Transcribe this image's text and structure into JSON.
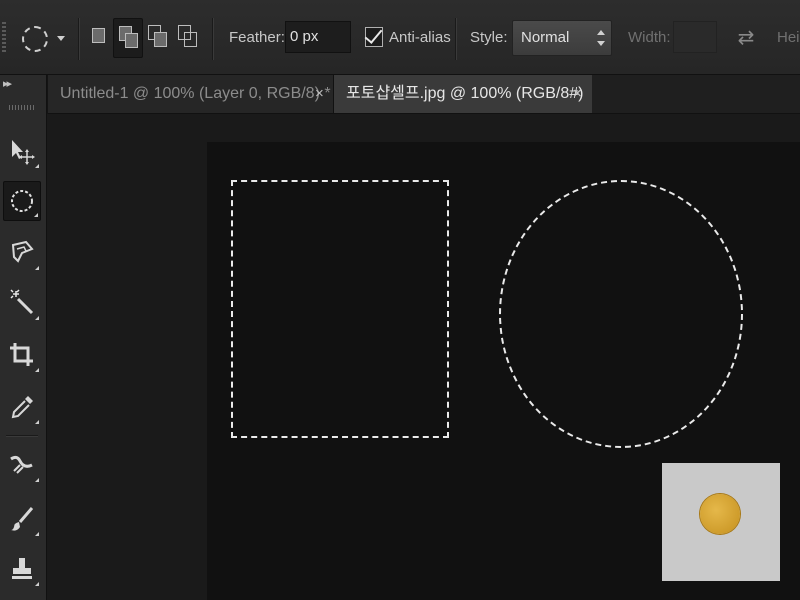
{
  "options_bar": {
    "feather_label": "Feather:",
    "feather_value": "0 px",
    "antialias_label": "Anti-alias",
    "antialias_checked": true,
    "style_label": "Style:",
    "style_value": "Normal",
    "width_label": "Width:",
    "height_label": "Heig",
    "tool_icon": "elliptical-marquee-icon",
    "selection_modes": [
      "new-selection",
      "add-to-selection",
      "subtract-from-selection",
      "intersect-with-selection"
    ],
    "active_selection_mode": "add-to-selection"
  },
  "tabs": [
    {
      "label": "Untitled-1 @ 100% (Layer 0, RGB/8) *",
      "close": "×",
      "active": false
    },
    {
      "label": "포토샵셀프.jpg @ 100% (RGB/8#)",
      "close": "×",
      "active": true
    }
  ],
  "tools_panel": {
    "collapse_glyph": "▸▸",
    "tools": [
      "move-tool-icon",
      "elliptical-marquee-tool-icon",
      "lasso-tool-icon",
      "magic-wand-tool-icon",
      "crop-tool-icon",
      "eyedropper-tool-icon",
      "healing-brush-tool-icon",
      "brush-tool-icon",
      "clone-stamp-tool-icon"
    ],
    "active_tool": "elliptical-marquee-tool-icon"
  },
  "canvas": {
    "background": "#111111",
    "selections": [
      "rectangle",
      "ellipse"
    ]
  },
  "colors": {
    "panel": "#2b2b2b",
    "canvas": "#111111",
    "marquee": "#eaeaea"
  }
}
